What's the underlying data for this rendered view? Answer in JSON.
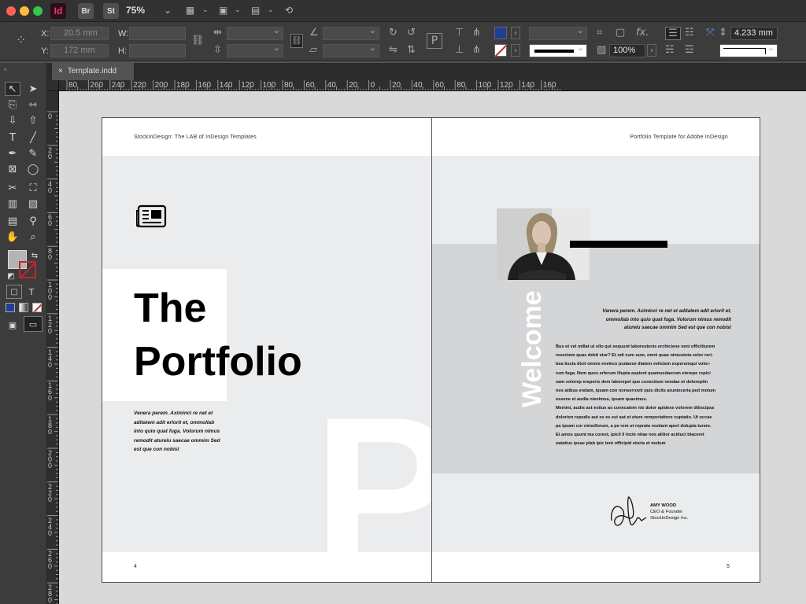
{
  "app": {
    "badges": [
      "Id",
      "Br",
      "St"
    ],
    "zoom": "75%",
    "colors": {
      "indesign_pink": "#ff3366",
      "accent_blue": "#1e3f96",
      "stroke_red": "#c1272d"
    }
  },
  "control_panel": {
    "x_label": "X:",
    "y_label": "Y:",
    "w_label": "W:",
    "h_label": "H:",
    "x_value": "20.5 mm",
    "y_value": "172 mm",
    "w_value": "",
    "h_value": "",
    "weight_value": "4.233 mm",
    "opacity_value": "100%",
    "fx_label": "fx."
  },
  "document": {
    "tab_title": "Template.indd",
    "close_glyph": "×"
  },
  "ruler": {
    "h_labels": [
      "80",
      "260",
      "240",
      "220",
      "200",
      "180",
      "160",
      "140",
      "120",
      "100",
      "80",
      "60",
      "40",
      "20",
      "0",
      "20",
      "40",
      "60",
      "80",
      "100",
      "120",
      "140",
      "160"
    ],
    "v_labels": [
      "0",
      "2 0",
      "4 0",
      "6 0",
      "8 0",
      "1 0 0",
      "1 2 0",
      "1 4 0",
      "1 6 0",
      "1 8 0",
      "2 0 0",
      "2 2 0",
      "2 4 0",
      "2 6 0",
      "2 8 0"
    ]
  },
  "left_page": {
    "header": "StockInDesign: The LAB of InDesign Templates",
    "title_line1": "The",
    "title_line2": "Portfolio",
    "intro_lines": [
      "Venera perem. Aximinci re net et",
      "aditatem adit erlorit et, ommollab",
      "into quio quat fuga. Volorum nimus",
      "remodit aturelu saecae ommim Sed",
      "est que con nobist"
    ],
    "big_letter": "P",
    "page_number": "4"
  },
  "right_page": {
    "header": "Portfolio Template for Adobe InDesign",
    "welcome": "Welcome",
    "quote_lines": [
      "Venera perem. Aximinci re net et aditatem adit erlorit et,",
      "ommollab into quio quat fuga. Volorum nimus remodit",
      "aturelu saecae ommim Sed est que con nobist"
    ],
    "body_lines": [
      "Bus et vel millat ut ello qui sequunt laborestenis erchiciene veni officitiurem",
      "resectem quas debit etur? Et odi cum sum, omni quae nimustota volor reri-",
      "bea tiscia dicit omnis evelece pudaese diatem velictem experumqui volor-",
      "rum fuga. Nem quos erferum illupta aspient quamusdaerum eterepe rspici",
      "sam volorep ereperis dem laborepel que conectium vendae et doloreptin",
      "nos atibus endam, ipsam con nonserrovit quis dicits arunteceria ped molum",
      "essene et audia nienimus, ipsam quasimus.",
      "Menimi, audis ast estius as conecatem nis dolor apidese volorem ditiscipsa",
      "dolorion repedis aut ex es est aut et eture remporiattore cuptatio. Ut occae",
      "pa ipsam cor minollorum, a pe rem ut repratu restiant aperi dolupta turem.",
      "Et amos quunt ma corest, ipicil il incte nitae nos alitior aciduci blaceret",
      "eatatius ipsae plab ipic tent officipid eturia et molum"
    ],
    "signer_name": "AMY WOOD",
    "signer_role": "CEO & Founder",
    "signer_company": "StockInDesign Inc.",
    "page_number": "5"
  }
}
